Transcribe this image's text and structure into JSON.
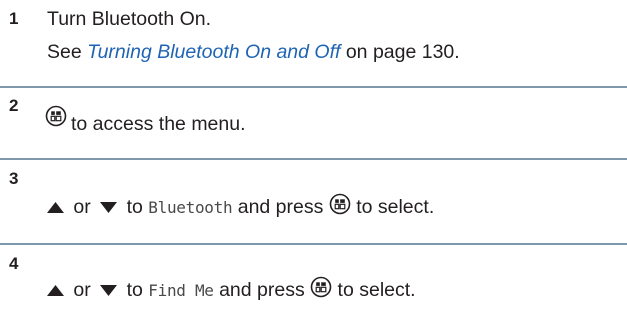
{
  "steps": [
    {
      "number": "1",
      "text": "Turn Bluetooth On.",
      "sub_prefix": "See ",
      "sub_link": "Turning Bluetooth On and Off",
      "sub_suffix": " on page 130."
    },
    {
      "number": "2",
      "icon": "menu-ok-button-icon",
      "text": "to access the menu."
    },
    {
      "number": "3",
      "icons": [
        "up-arrow-icon",
        "down-arrow-icon",
        "menu-ok-button-icon"
      ],
      "or": "or",
      "to": "to",
      "menu_item": "Bluetooth",
      "and_press": "and press",
      "to_select": "to select."
    },
    {
      "number": "4",
      "icons": [
        "up-arrow-icon",
        "down-arrow-icon",
        "menu-ok-button-icon"
      ],
      "or": "or",
      "to": "to",
      "menu_item": "Find Me",
      "and_press": "and press",
      "to_select": "to select."
    }
  ],
  "colors": {
    "text": "#231f20",
    "link": "#1f64b4",
    "rule": "#7f97ad"
  }
}
